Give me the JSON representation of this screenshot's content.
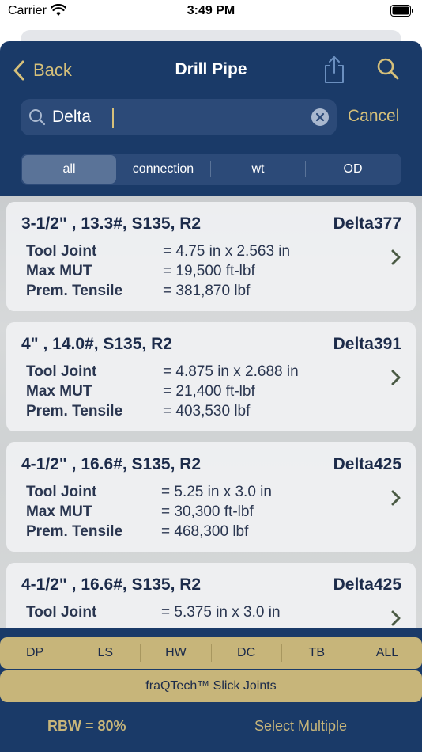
{
  "status_bar": {
    "carrier": "Carrier",
    "time": "3:49 PM"
  },
  "nav": {
    "back_label": "Back",
    "title": "Drill Pipe"
  },
  "search": {
    "value": "Delta",
    "cancel_label": "Cancel"
  },
  "segments": [
    {
      "label": "all",
      "active": true
    },
    {
      "label": "connection",
      "active": false
    },
    {
      "label": "wt",
      "active": false
    },
    {
      "label": "OD",
      "active": false
    }
  ],
  "cards": [
    {
      "title": "3-1/2\" , 13.3#, S135, R2",
      "code": "Delta377",
      "rows": [
        {
          "label": "Tool Joint",
          "value": "= 4.75 in x 2.563 in"
        },
        {
          "label": "Max MUT",
          "value": "= 19,500 ft-lbf"
        },
        {
          "label": "Prem. Tensile",
          "value": "= 381,870 lbf"
        }
      ]
    },
    {
      "title": "4\" , 14.0#, S135, R2",
      "code": "Delta391",
      "rows": [
        {
          "label": "Tool Joint",
          "value": "= 4.875 in x 2.688 in"
        },
        {
          "label": "Max MUT",
          "value": "= 21,400 ft-lbf"
        },
        {
          "label": "Prem. Tensile",
          "value": "= 403,530 lbf"
        }
      ]
    },
    {
      "title": "4-1/2\" , 16.6#, S135, R2",
      "code": "Delta425",
      "rows": [
        {
          "label": "Tool Joint",
          "value": "= 5.25 in x 3.0 in"
        },
        {
          "label": "Max MUT",
          "value": "= 30,300 ft-lbf"
        },
        {
          "label": "Prem. Tensile",
          "value": "= 468,300 lbf"
        }
      ]
    },
    {
      "title": "4-1/2\" , 16.6#, S135, R2",
      "code": "Delta425",
      "rows": [
        {
          "label": "Tool Joint",
          "value": "= 5.375 in x 3.0 in"
        }
      ]
    }
  ],
  "bottom_tabs": [
    "DP",
    "LS",
    "HW",
    "DC",
    "TB",
    "ALL"
  ],
  "slick_joints_label": "fraQTech™ Slick Joints",
  "rbw_label": "RBW = 80%",
  "select_multiple_label": "Select Multiple",
  "colors": {
    "navy": "#1a3a68",
    "gold": "#c7b57a",
    "accent_text": "#d6c07a"
  }
}
